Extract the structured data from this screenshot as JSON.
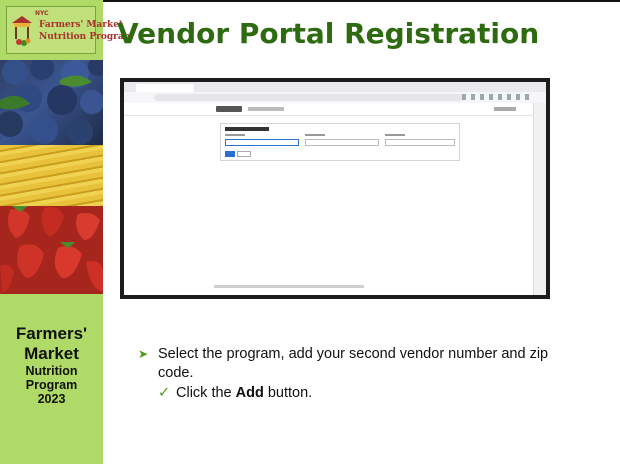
{
  "slide": {
    "title": "Vendor Portal Registration",
    "sidebar": {
      "logo": {
        "mini": "NYC",
        "line1": "Farmers' Market",
        "line2": "Nutrition Program"
      },
      "caption_line1": "Farmers'",
      "caption_line2": "Market",
      "caption_line3": "Nutrition",
      "caption_line4": "Program",
      "caption_line5": "2023"
    },
    "bullets": {
      "main": "Select the program, add your second vendor number and zip code.",
      "sub_prefix": "Click the ",
      "sub_bold": "Add",
      "sub_suffix": " button.",
      "main_marker": "➤",
      "sub_marker": "✓"
    }
  },
  "colors": {
    "sidebar": "#b0da67",
    "title": "#2e6a0f",
    "bullet_marker": "#4c9a1a",
    "logo_text": "#a8322c"
  }
}
